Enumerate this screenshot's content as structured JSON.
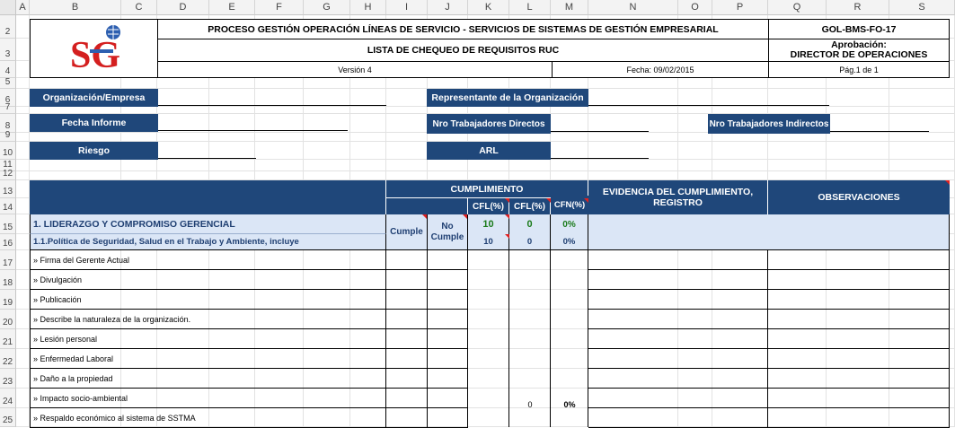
{
  "sheet": {
    "columns": [
      "A",
      "B",
      "C",
      "D",
      "E",
      "F",
      "G",
      "H",
      "I",
      "J",
      "K",
      "L",
      "M",
      "N",
      "O",
      "P",
      "Q",
      "R",
      "S"
    ],
    "rows": [
      "2",
      "3",
      "4",
      "5",
      "6",
      "7",
      "8",
      "9",
      "10",
      "11",
      "12",
      "13",
      "14",
      "15",
      "16",
      "17",
      "18",
      "19",
      "20",
      "21",
      "22",
      "23",
      "24",
      "25"
    ]
  },
  "header": {
    "title": "PROCESO GESTIÓN OPERACIÓN LÍNEAS DE SERVICIO - SERVICIOS DE SISTEMAS DE GESTIÓN EMPRESARIAL",
    "code": "GOL-BMS-FO-17",
    "subtitle": "LISTA DE CHEQUEO DE REQUISITOS  RUC",
    "approval_label": "Aprobación:",
    "approval_value": "DIRECTOR DE OPERACIONES",
    "version": "Versión  4",
    "date": "Fecha:  09/02/2015",
    "page": "Pág.1 de 1",
    "logo_text": "SG"
  },
  "info": {
    "org": "Organización/Empresa",
    "rep": "Representante de la Organización",
    "date_report": "Fecha Informe",
    "workers_direct": "Nro Trabajadores Directos",
    "workers_indirect": "Nro Trabajadores Indirectos",
    "risk": "Riesgo",
    "arl": "ARL"
  },
  "table": {
    "cumplimiento": "CUMPLIMIENTO",
    "evidencia": "EVIDENCIA DEL CUMPLIMIENTO, REGISTRO",
    "observaciones": "OBSERVACIONES",
    "cumple": "Cumple",
    "no_cumple": "No Cumple",
    "cfl1": "CFL(%)",
    "cfl2": "CFL(%)",
    "cfn": "CFN(%)",
    "sec1": {
      "label": "1. LIDERAZGO Y COMPROMISO GERENCIAL",
      "v1": "10",
      "v2": "0",
      "v3": "0%"
    },
    "sec11": {
      "label": "1.1.Política de Seguridad, Salud en el Trabajo y Ambiente,  incluye",
      "v1": "10",
      "v2": "0",
      "v3": "0%"
    },
    "items": [
      "» Firma del Gerente Actual",
      "» Divulgación",
      "» Publicación",
      "» Describe la naturaleza de la organización.",
      "» Lesión personal",
      "» Enfermedad Laboral",
      "» Daño a la propiedad",
      "» Impacto socio-ambiental",
      "» Respaldo económico al sistema de SSTMA"
    ],
    "side_v2": "0",
    "side_v3": "0%"
  },
  "colors": {
    "navy": "#1f477a",
    "light_blue": "#dbe6f6",
    "green": "#1b7b1b",
    "marker": "#e02020"
  }
}
